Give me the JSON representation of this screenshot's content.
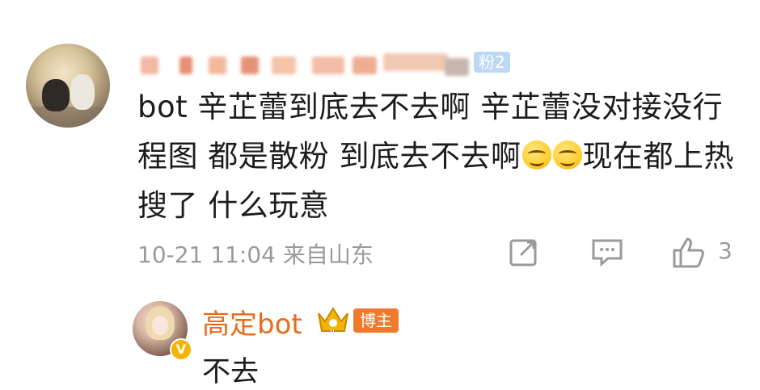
{
  "comment": {
    "fans_badge": "粉2",
    "text_parts": [
      "bot 辛芷蕾到底去不去啊 辛芷蕾没对接没行程图 都是散粉 到底去不去啊",
      "现在都上热搜了 什么玩意"
    ],
    "emojis": [
      "grin-emoji",
      "grin-emoji"
    ],
    "meta": "10-21 11:04 来自山东",
    "like_count": "3"
  },
  "reply": {
    "name": "高定bot",
    "badge": "博主",
    "text": "不去"
  },
  "colors": {
    "accent_orange": "#f07a2b",
    "name_orange": "#e86b1a",
    "fans_blue": "#bcd8f3",
    "meta_gray": "#9a9a9a"
  },
  "icons": {
    "share": "share-icon",
    "reply": "comment-icon",
    "like": "thumbs-up-icon",
    "crown": "crown-icon",
    "verified": "verified-v-icon"
  }
}
